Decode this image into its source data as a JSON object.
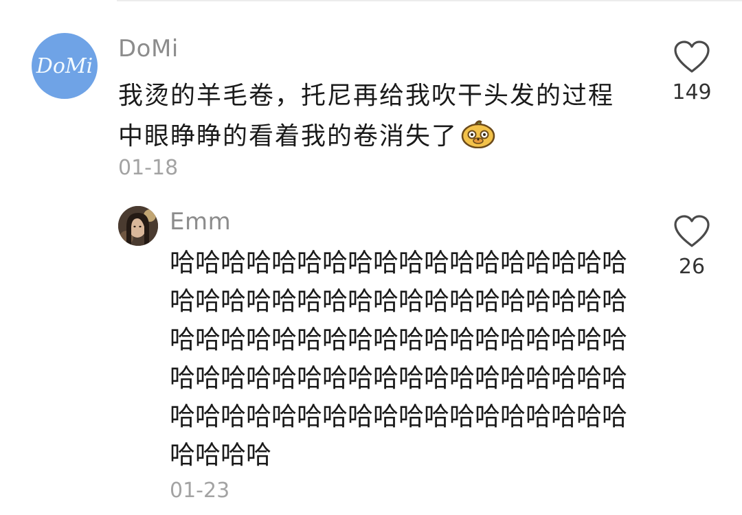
{
  "comments": [
    {
      "username": "DoMi",
      "avatar_text": "DoMi",
      "text": "我烫的羊毛卷，托尼再给我吹干头发的过程中眼睁睁的看着我的卷消失了",
      "emoji": "cute-face-emoji",
      "date": "01-18",
      "likes": "149",
      "replies": [
        {
          "username": "Emm",
          "text": "哈哈哈哈哈哈哈哈哈哈哈哈哈哈哈哈哈哈哈哈哈哈哈哈哈哈哈哈哈哈哈哈哈哈哈哈哈哈哈哈哈哈哈哈哈哈哈哈哈哈哈哈哈哈哈哈哈哈哈哈哈哈哈哈哈哈哈哈哈哈哈哈哈哈哈哈哈哈哈哈哈哈哈哈哈哈哈哈哈哈哈哈哈哈",
          "date": "01-23",
          "likes": "26"
        }
      ]
    }
  ],
  "icons": {
    "like": "heart-outline-icon",
    "avatar_color": "#6fa3e6",
    "heart_color": "#4a4a4a"
  }
}
